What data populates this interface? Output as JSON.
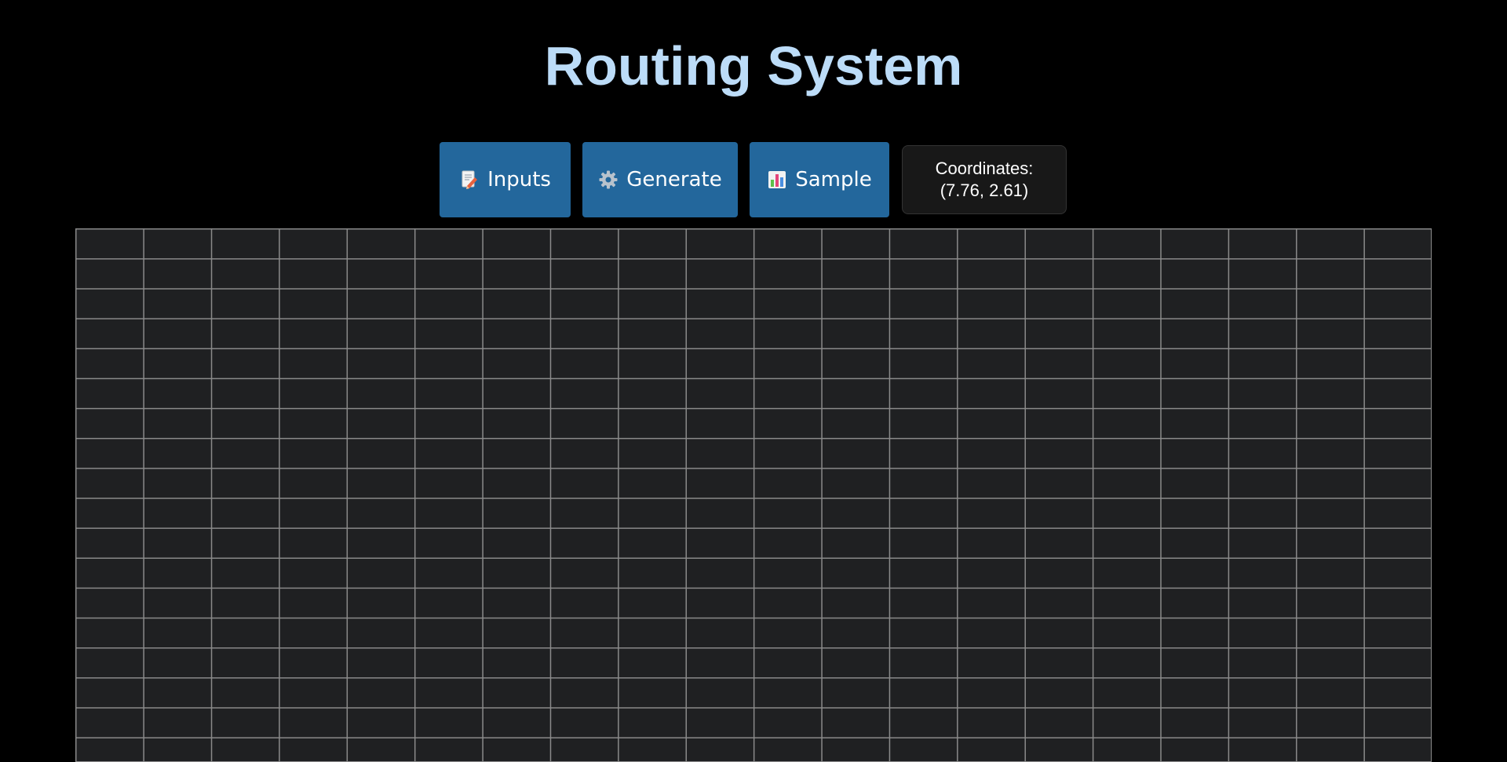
{
  "header": {
    "title": "Routing System"
  },
  "toolbar": {
    "buttons": [
      {
        "label": "Inputs",
        "icon": "memo-pencil-icon"
      },
      {
        "label": "Generate",
        "icon": "gear-icon"
      },
      {
        "label": "Sample",
        "icon": "bar-chart-icon"
      }
    ]
  },
  "coordinates": {
    "label": "Coordinates:",
    "value": "(7.76, 2.61)"
  },
  "colors": {
    "background": "#000000",
    "title": "#bcdcf8",
    "button": "#23679c",
    "grid_background": "#1f2022",
    "grid_lines": "#8a8a8a"
  }
}
